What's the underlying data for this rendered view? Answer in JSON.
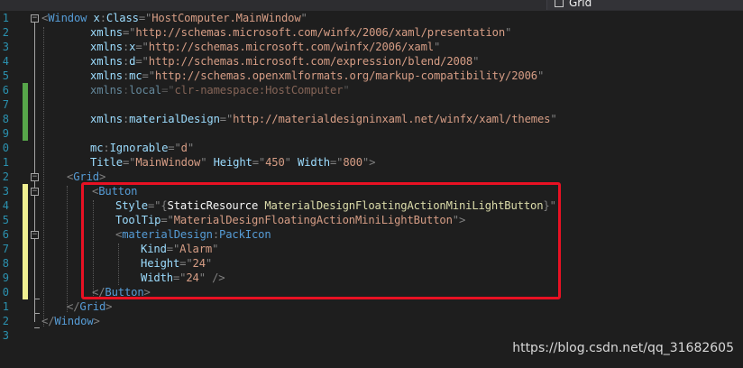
{
  "editor": {
    "breadcrumb": {
      "label": "Grid",
      "icon": "element-icon"
    },
    "line_numbers": [
      "1",
      "2",
      "3",
      "4",
      "5",
      "6",
      "7",
      "8",
      "9",
      "0",
      "1",
      "2",
      "3",
      "4",
      "5",
      "6",
      "7",
      "8",
      "9",
      "0",
      "1",
      "2",
      "3"
    ],
    "lines": [
      [
        [
          "p",
          "<"
        ],
        [
          "t",
          "Window"
        ],
        [
          "a",
          " x"
        ],
        [
          "p",
          ":"
        ],
        [
          "a",
          "Class"
        ],
        [
          "p",
          "=\""
        ],
        [
          "v",
          "HostComputer.MainWindow"
        ],
        [
          "p",
          "\""
        ]
      ],
      [
        [
          "a",
          "xmlns"
        ],
        [
          "p",
          "=\""
        ],
        [
          "v",
          "http://schemas.microsoft.com/winfx/2006/xaml/presentation"
        ],
        [
          "p",
          "\""
        ]
      ],
      [
        [
          "a",
          "xmlns"
        ],
        [
          "p",
          ":"
        ],
        [
          "a",
          "x"
        ],
        [
          "p",
          "=\""
        ],
        [
          "v",
          "http://schemas.microsoft.com/winfx/2006/xaml"
        ],
        [
          "p",
          "\""
        ]
      ],
      [
        [
          "a",
          "xmlns"
        ],
        [
          "p",
          ":"
        ],
        [
          "a",
          "d"
        ],
        [
          "p",
          "=\""
        ],
        [
          "v",
          "http://schemas.microsoft.com/expression/blend/2008"
        ],
        [
          "p",
          "\""
        ]
      ],
      [
        [
          "a",
          "xmlns"
        ],
        [
          "p",
          ":"
        ],
        [
          "a",
          "mc"
        ],
        [
          "p",
          "=\""
        ],
        [
          "v",
          "http://schemas.openxmlformats.org/markup-compatibility/2006"
        ],
        [
          "p",
          "\""
        ]
      ],
      [
        [
          "a",
          "xmlns"
        ],
        [
          "p",
          ":"
        ],
        [
          "a",
          "local"
        ],
        [
          "p",
          "=\""
        ],
        [
          "v",
          "clr-namespace:HostComputer"
        ],
        [
          "p",
          "\""
        ]
      ],
      [],
      [
        [
          "a",
          "xmlns"
        ],
        [
          "p",
          ":"
        ],
        [
          "a",
          "materialDesign"
        ],
        [
          "p",
          "=\""
        ],
        [
          "v",
          "http://materialdesigninxaml.net/winfx/xaml/themes"
        ],
        [
          "p",
          "\""
        ]
      ],
      [],
      [
        [
          "a",
          "mc"
        ],
        [
          "p",
          ":"
        ],
        [
          "a",
          "Ignorable"
        ],
        [
          "p",
          "=\""
        ],
        [
          "v",
          "d"
        ],
        [
          "p",
          "\""
        ]
      ],
      [
        [
          "a",
          "Title"
        ],
        [
          "p",
          "=\""
        ],
        [
          "v",
          "MainWindow"
        ],
        [
          "p",
          "\""
        ],
        [
          "a",
          " Height"
        ],
        [
          "p",
          "=\""
        ],
        [
          "v",
          "450"
        ],
        [
          "p",
          "\""
        ],
        [
          "a",
          " Width"
        ],
        [
          "p",
          "=\""
        ],
        [
          "v",
          "800"
        ],
        [
          "p",
          "\">"
        ]
      ],
      [
        [
          "p",
          "<"
        ],
        [
          "t",
          "Grid"
        ],
        [
          "p",
          ">"
        ]
      ],
      [
        [
          "p",
          "<"
        ],
        [
          "t",
          "Button"
        ]
      ],
      [
        [
          "a",
          "Style"
        ],
        [
          "p",
          "=\"{"
        ],
        [
          "s",
          "StaticResource"
        ],
        [
          "m",
          " MaterialDesignFloatingActionMiniLightButton"
        ],
        [
          "p",
          "}\""
        ]
      ],
      [
        [
          "a",
          "ToolTip"
        ],
        [
          "p",
          "=\""
        ],
        [
          "v",
          "MaterialDesignFloatingActionMiniLightButton"
        ],
        [
          "p",
          "\">"
        ]
      ],
      [
        [
          "p",
          "<"
        ],
        [
          "t",
          "materialDesign"
        ],
        [
          "p",
          ":"
        ],
        [
          "t",
          "PackIcon"
        ]
      ],
      [
        [
          "a",
          "Kind"
        ],
        [
          "p",
          "=\""
        ],
        [
          "v",
          "Alarm"
        ],
        [
          "p",
          "\""
        ]
      ],
      [
        [
          "a",
          "Height"
        ],
        [
          "p",
          "=\""
        ],
        [
          "v",
          "24"
        ],
        [
          "p",
          "\""
        ]
      ],
      [
        [
          "a",
          "Width"
        ],
        [
          "p",
          "=\""
        ],
        [
          "v",
          "24"
        ],
        [
          "p",
          "\" />"
        ]
      ],
      [
        [
          "p",
          "</"
        ],
        [
          "t",
          "Button"
        ],
        [
          "p",
          ">"
        ]
      ],
      [
        [
          "p",
          "</"
        ],
        [
          "t",
          "Grid"
        ],
        [
          "p",
          ">"
        ]
      ],
      [
        [
          "p",
          "</"
        ],
        [
          "t",
          "Window"
        ],
        [
          "p",
          ">"
        ]
      ],
      []
    ],
    "dimmed_lines": [
      5
    ],
    "colors": {
      "background": "#1e1e1e",
      "line_number": "#2b91af",
      "tag": "#569cd6",
      "attribute": "#9cdcfe",
      "value": "#d69d85",
      "punctuation": "#808080",
      "markup_extension": "#dcdcaa",
      "saved_change": "#57a64a",
      "unsaved_change": "#efef91",
      "highlight_box": "#e81123"
    }
  },
  "watermark": "https://blog.csdn.net/qq_31682605"
}
